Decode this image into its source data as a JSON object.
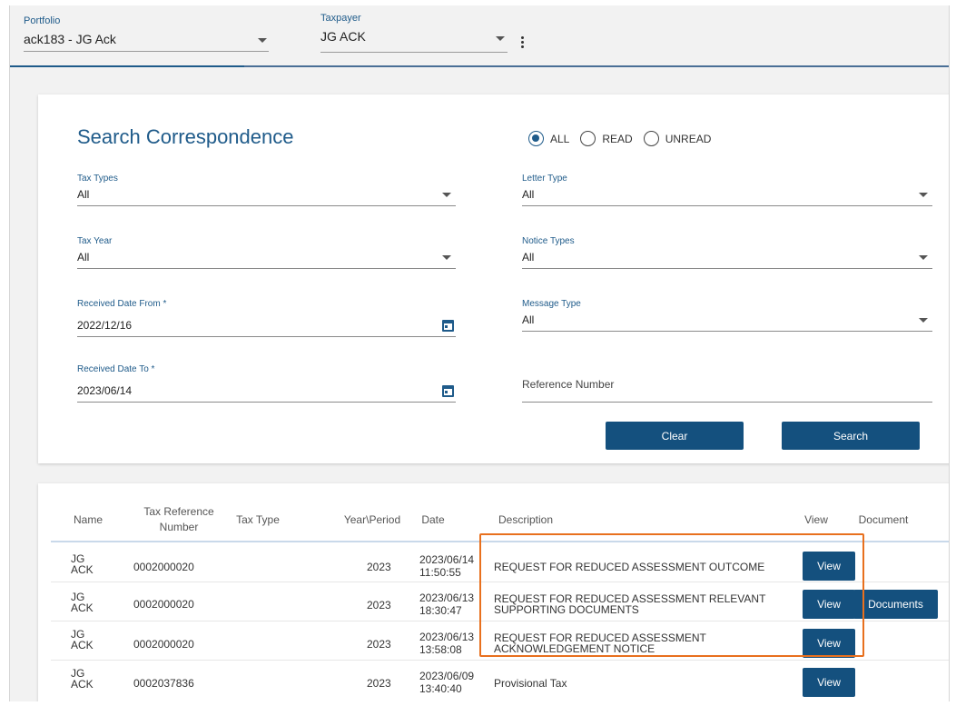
{
  "header": {
    "portfolio_label": "Portfolio",
    "portfolio_value": "ack183 - JG Ack",
    "taxpayer_label": "Taxpayer",
    "taxpayer_value": "JG ACK"
  },
  "search": {
    "title": "Search Correspondence",
    "radios": [
      "ALL",
      "READ",
      "UNREAD"
    ],
    "selected_radio": "ALL",
    "tax_types_label": "Tax Types",
    "tax_types_value": "All",
    "tax_year_label": "Tax Year",
    "tax_year_value": "All",
    "received_from_label": "Received Date From *",
    "received_from_value": "2022/12/16",
    "received_to_label": "Received Date To *",
    "received_to_value": "2023/06/14",
    "letter_type_label": "Letter Type",
    "letter_type_value": "All",
    "notice_types_label": "Notice Types",
    "notice_types_value": "All",
    "message_type_label": "Message Type",
    "message_type_value": "All",
    "reference_number_placeholder": "Reference Number",
    "clear_label": "Clear",
    "search_label": "Search"
  },
  "results": {
    "columns": [
      "Name",
      "Tax Reference Number",
      "Tax Type",
      "Year\\Period",
      "Date",
      "Description",
      "View",
      "Document"
    ],
    "rows": [
      {
        "name": "JG ACK",
        "ref": "0002000020",
        "tax_type": "",
        "year": "2023",
        "date": "2023/06/14",
        "time": "11:50:55",
        "desc": "REQUEST FOR REDUCED ASSESSMENT OUTCOME",
        "view": "View",
        "document": ""
      },
      {
        "name": "JG ACK",
        "ref": "0002000020",
        "tax_type": "",
        "year": "2023",
        "date": "2023/06/13",
        "time": "18:30:47",
        "desc": "REQUEST FOR REDUCED ASSESSMENT RELEVANT SUPPORTING DOCUMENTS",
        "view": "View",
        "document": "Documents"
      },
      {
        "name": "JG ACK",
        "ref": "0002000020",
        "tax_type": "",
        "year": "2023",
        "date": "2023/06/13",
        "time": "13:58:08",
        "desc": "REQUEST FOR REDUCED ASSESSMENT ACKNOWLEDGEMENT NOTICE",
        "view": "View",
        "document": ""
      },
      {
        "name": "JG ACK",
        "ref": "0002037836",
        "tax_type": "",
        "year": "2023",
        "date": "2023/06/09",
        "time": "13:40:40",
        "desc": "Provisional Tax",
        "view": "View",
        "document": ""
      }
    ]
  },
  "colors": {
    "primary": "#14507e",
    "accent_label": "#1f5b8a",
    "highlight": "#e8701e"
  }
}
